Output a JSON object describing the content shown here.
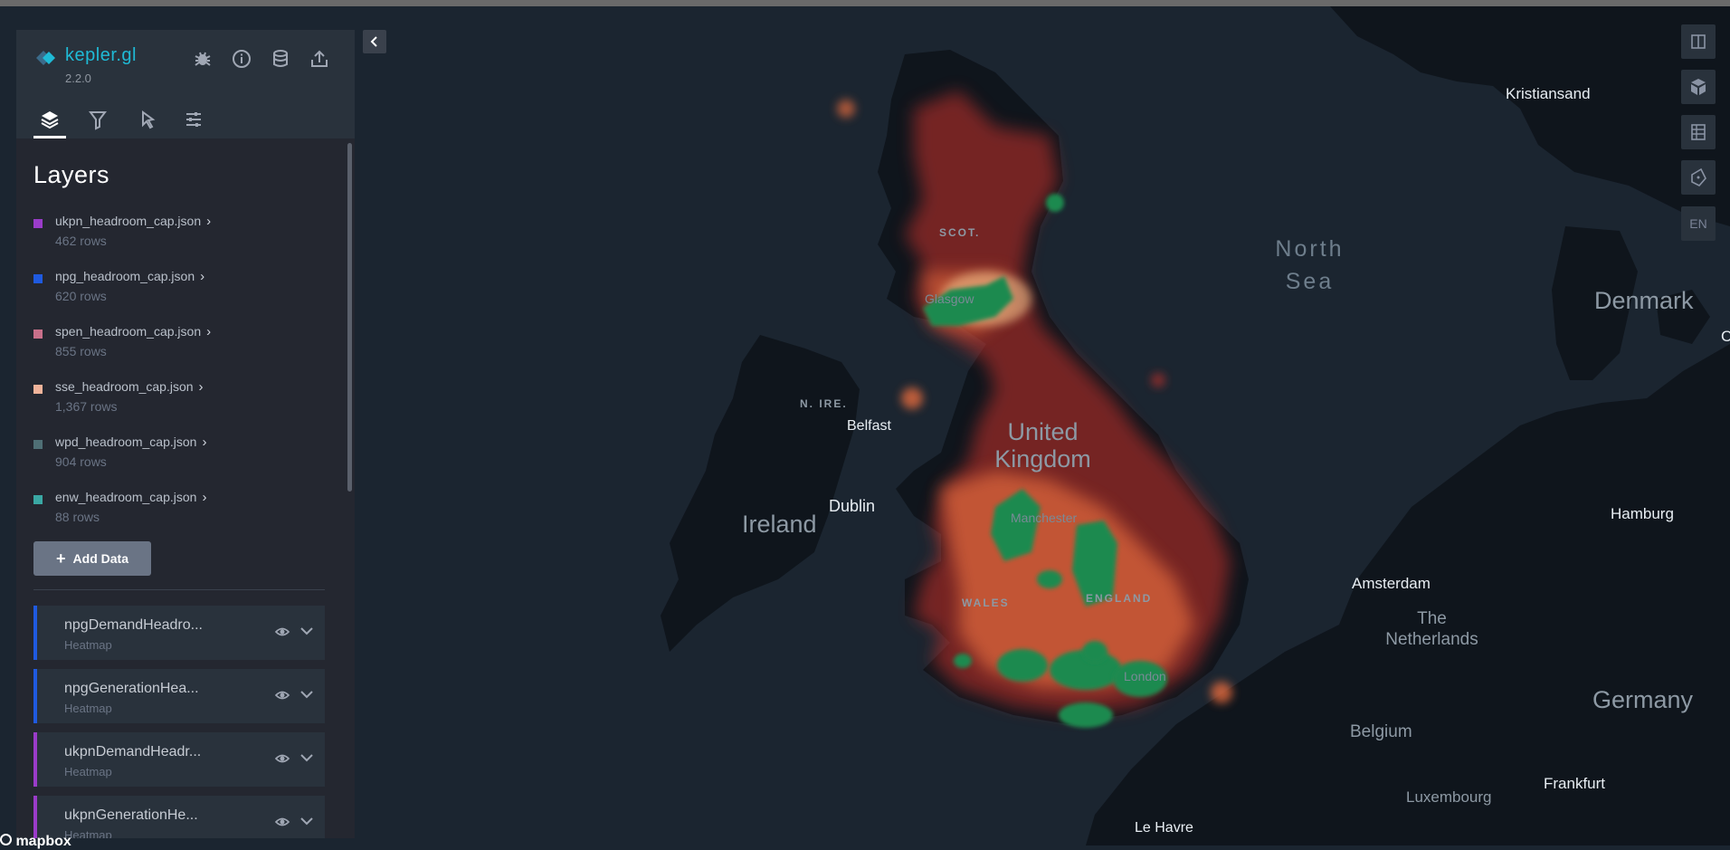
{
  "app": {
    "name": "kepler.gl",
    "version": "2.2.0"
  },
  "header_icons": [
    "bug-icon",
    "info-icon",
    "database-icon",
    "share-icon"
  ],
  "tabs": [
    {
      "name": "layers-icon",
      "active": true
    },
    {
      "name": "filter-icon",
      "active": false
    },
    {
      "name": "interaction-icon",
      "active": false
    },
    {
      "name": "map-settings-icon",
      "active": false
    }
  ],
  "layers_panel": {
    "title": "Layers",
    "datasets": [
      {
        "name": "ukpn_headroom_cap.json",
        "rows": "462 rows",
        "color": "#9a3cc9"
      },
      {
        "name": "npg_headroom_cap.json",
        "rows": "620 rows",
        "color": "#1f5ae0"
      },
      {
        "name": "spen_headroom_cap.json",
        "rows": "855 rows",
        "color": "#c8708a"
      },
      {
        "name": "sse_headroom_cap.json",
        "rows": "1,367 rows",
        "color": "#f0b39a"
      },
      {
        "name": "wpd_headroom_cap.json",
        "rows": "904 rows",
        "color": "#4f6f75"
      },
      {
        "name": "enw_headroom_cap.json",
        "rows": "88 rows",
        "color": "#3aa8a4"
      }
    ],
    "add_data_label": "Add Data",
    "layer_cards": [
      {
        "title": "npgDemandHeadro...",
        "type": "Heatmap",
        "color": "#1f5ae0"
      },
      {
        "title": "npgGenerationHea...",
        "type": "Heatmap",
        "color": "#1f5ae0"
      },
      {
        "title": "ukpnDemandHeadr...",
        "type": "Heatmap",
        "color": "#9a3cc9"
      },
      {
        "title": "ukpnGenerationHe...",
        "type": "Heatmap",
        "color": "#9a3cc9"
      }
    ]
  },
  "map_controls": {
    "language": "EN"
  },
  "map_labels": {
    "kristiansand": "Kristiansand",
    "north_sea_1": "North",
    "north_sea_2": "Sea",
    "denmark": "Denmark",
    "scot": "SCOT.",
    "glasgow": "Glasgow",
    "n_ire": "N. IRE.",
    "belfast": "Belfast",
    "uk_1": "United",
    "uk_2": "Kingdom",
    "ireland": "Ireland",
    "dublin": "Dublin",
    "manchester": "Manchester",
    "hamburg": "Hamburg",
    "amsterdam": "Amsterdam",
    "netherlands_1": "The",
    "netherlands_2": "Netherlands",
    "wales": "WALES",
    "england": "ENGLAND",
    "london": "London",
    "germany": "Germany",
    "belgium": "Belgium",
    "luxembourg": "Luxembourg",
    "frankfurt": "Frankfurt",
    "le_havre": "Le Havre",
    "edge_letter": "C"
  },
  "attribution": "mapbox"
}
